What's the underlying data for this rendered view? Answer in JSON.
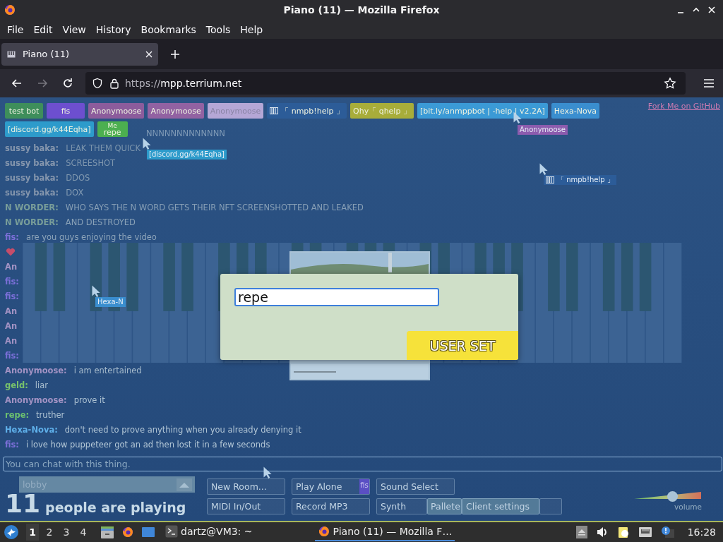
{
  "window": {
    "title": "Piano (11) — Mozilla Firefox"
  },
  "menu": [
    "File",
    "Edit",
    "View",
    "History",
    "Bookmarks",
    "Tools",
    "Help"
  ],
  "tabs": [
    {
      "label": "Piano (11)",
      "selected": true
    }
  ],
  "nav_buttons": [
    {
      "kind": "back",
      "disabled": false
    },
    {
      "kind": "forward",
      "disabled": true
    },
    {
      "kind": "reload",
      "disabled": false
    }
  ],
  "address": {
    "scheme": "https://",
    "host": "mpp.terrium.net"
  },
  "room": {
    "name_tags": [
      {
        "name": "test bot",
        "kind": "user",
        "color": "#3e8e5b"
      },
      {
        "name": "fis",
        "kind": "user",
        "color": "#6d4fcf"
      },
      {
        "name": "Anonymoose",
        "kind": "user",
        "color": "#8c5c9c"
      },
      {
        "name": "Anonymoose",
        "kind": "user",
        "color": "#9262a2"
      },
      {
        "name": "Anonymoose",
        "kind": "user",
        "color": "#b5a7d6"
      },
      {
        "name": "「 nmpb!help 」",
        "kind": "bot",
        "color": "#2c5c98"
      },
      {
        "name": "Qhy「 qhelp 」",
        "kind": "user",
        "color": "#a8ad3a"
      },
      {
        "name": "[bit.ly/anmppbot | -help | v2.2A]",
        "kind": "user",
        "color": "#3b9ad6"
      },
      {
        "name": "Hexa-Nova",
        "kind": "user",
        "color": "#3a8ecf"
      },
      {
        "name": "[discord.gg/k44Eqha]",
        "kind": "user",
        "color": "#2d9bcb"
      },
      {
        "name": "repe",
        "kind": "me",
        "note": "Me",
        "color": "#4caf50"
      }
    ],
    "github_link": "Fork Me on GitHub",
    "cursors": [
      {
        "kind": "user",
        "label": "[discord.gg/k44Eqha]",
        "color": "#2d9bcb"
      },
      {
        "kind": "user",
        "label": "Anonymoose",
        "color": "#8c5cae"
      },
      {
        "kind": "bot",
        "label": "「 nmpb!help 」",
        "color": "#2c5c98"
      },
      {
        "kind": "user",
        "label": "Hexa-N",
        "color": "#3a8ecf"
      },
      {
        "kind": "bare"
      }
    ],
    "chat": [
      {
        "kind": "covered",
        "message": "NNNNNNNNNNNNN"
      },
      {
        "kind": "message",
        "name": "sussy baka:",
        "message": "LEAK THEM QUICK",
        "color": "#8596ad"
      },
      {
        "kind": "message",
        "name": "sussy baka:",
        "message": "SCREESHOT",
        "color": "#8596ad"
      },
      {
        "kind": "message",
        "name": "sussy baka:",
        "message": "DDOS",
        "color": "#8596ad"
      },
      {
        "kind": "message",
        "name": "sussy baka:",
        "message": "DOX",
        "color": "#8596ad"
      },
      {
        "kind": "message",
        "name": "N WORDER:",
        "message": "WHO SAYS THE N WORD GETS THEIR NFT SCREENSHOTTED AND LEAKED",
        "color": "#789d99"
      },
      {
        "kind": "message",
        "name": "N WORDER:",
        "message": "AND DESTROYED",
        "color": "#789d99"
      },
      {
        "kind": "message",
        "name": "fis:",
        "message": "are you guys enjoying the video",
        "color": "#7b6fd8"
      },
      {
        "kind": "heart"
      },
      {
        "kind": "message",
        "name": "An",
        "color": "#a393c4"
      },
      {
        "kind": "message",
        "name": "fis:",
        "color": "#7b6fd8"
      },
      {
        "kind": "message",
        "name": "fis:",
        "color": "#7b6fd8"
      },
      {
        "kind": "message",
        "name": "An",
        "color": "#a393c4"
      },
      {
        "kind": "message",
        "name": "An",
        "color": "#a393c4"
      },
      {
        "kind": "message",
        "name": "An",
        "color": "#a393c4"
      },
      {
        "kind": "message",
        "name": "fis:",
        "color": "#7b6fd8"
      },
      {
        "kind": "message",
        "name": "Anonymoose:",
        "message": "i am entertained",
        "color": "#a393c4"
      },
      {
        "kind": "message",
        "name": "geld:",
        "message": "liar",
        "color": "#79c36b"
      },
      {
        "kind": "message",
        "name": "Anonymoose:",
        "message": "prove it",
        "color": "#a393c4"
      },
      {
        "kind": "message",
        "name": "repe:",
        "message": "truther",
        "color": "#6cc070"
      },
      {
        "kind": "message",
        "name": "Hexa-Nova:",
        "message": "don't need to prove anything when you already denying it",
        "color": "#5fb0ea"
      },
      {
        "kind": "message",
        "name": "fis:",
        "message": "i love how puppeteer got an ad then lost it in a few seconds",
        "color": "#7b6fd8"
      }
    ],
    "chat_input": {
      "placeholder": "You can chat with this thing."
    },
    "room_select": {
      "value": "lobby"
    },
    "player_count": "11",
    "player_text": "people are playing",
    "buttons": [
      [
        {
          "label": "New Room..."
        },
        {
          "label": "Play Alone",
          "badge": "fis"
        },
        {
          "label": "Sound Select"
        }
      ],
      [
        {
          "label": "MIDI In/Out"
        },
        {
          "label": "Record MP3"
        },
        {
          "label": "Synth"
        }
      ]
    ],
    "overlay_buttons": [
      "Pallete",
      "Client settings"
    ],
    "volume": {
      "label": "volume"
    },
    "dialog": {
      "value": "repe",
      "button": "USER SET"
    }
  },
  "taskbar": {
    "workspaces": [
      {
        "label": "1",
        "selected": true
      },
      {
        "label": "2",
        "selected": false
      },
      {
        "label": "3",
        "selected": false
      },
      {
        "label": "4",
        "selected": false
      }
    ],
    "tasks": [
      {
        "kind": "terminal",
        "label": "dartz@VM3: ~",
        "selected": false
      },
      {
        "kind": "browser",
        "label": "Piano (11) — Mozilla F…",
        "selected": true
      }
    ],
    "clock": "16:28"
  }
}
